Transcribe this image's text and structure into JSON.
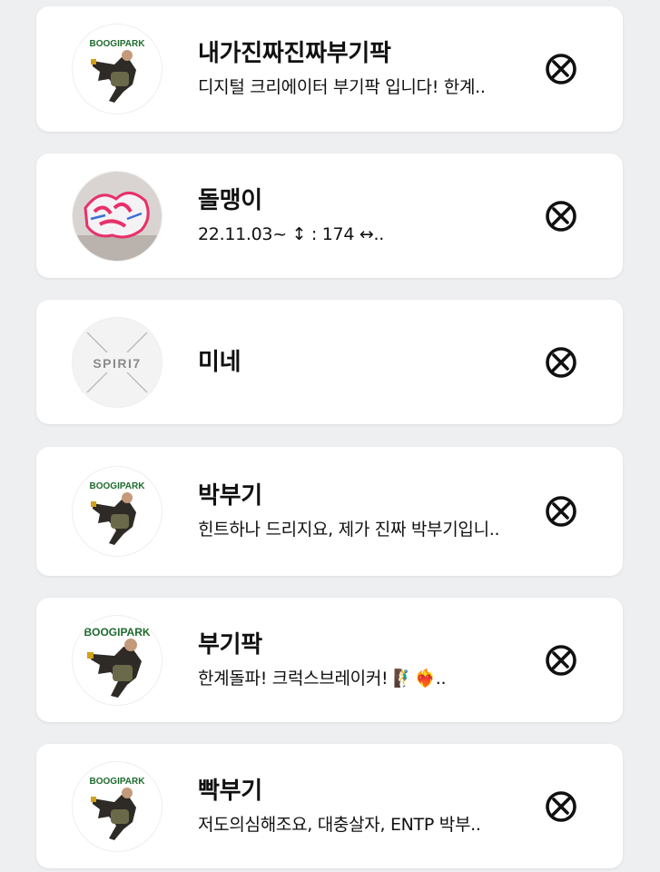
{
  "accent_color": "#111111",
  "background_color": "#eeeff1",
  "users": [
    {
      "name": "내가진짜진짜부기팍",
      "bio": "디지털 크리에이터 부기팍 입니다! 한계..",
      "avatar": "boogipark-logo",
      "avatar_text": "BOOGIPARK",
      "action_icon": "block-icon"
    },
    {
      "name": "돌맹이",
      "bio": "22.11.03~ ↕ : 174 ↔..",
      "avatar": "graffiti-image",
      "avatar_text": "",
      "action_icon": "block-icon"
    },
    {
      "name": "미네",
      "bio": "",
      "avatar": "spirit-logo",
      "avatar_text": "SPIRI7",
      "action_icon": "block-icon"
    },
    {
      "name": "박부기",
      "bio": "힌트하나 드리지요, 제가 진짜 박부기입니..",
      "avatar": "boogipark-logo",
      "avatar_text": "BOOGIPARK",
      "action_icon": "block-icon"
    },
    {
      "name": "부기팍",
      "bio": "한계돌파! 크럭스브레이커! 🧗‍♂️❤️‍🔥..",
      "avatar": "boogipark-logo",
      "avatar_text": "BOOGIPARK",
      "action_icon": "block-icon"
    },
    {
      "name": "빡부기",
      "bio": "저도의심해조요, 대충살자, ENTP 박부..",
      "avatar": "boogipark-logo",
      "avatar_text": "BOOGIPARK",
      "action_icon": "block-icon"
    }
  ]
}
